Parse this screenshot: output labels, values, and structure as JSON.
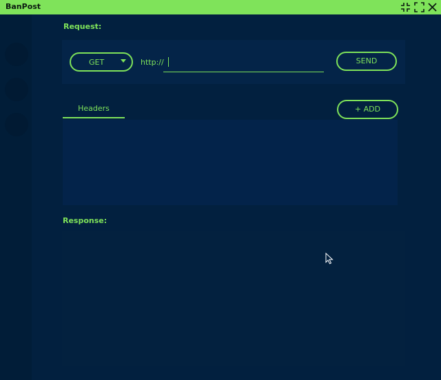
{
  "window": {
    "title": "BanPost"
  },
  "titlebar_icons": [
    "collapse-icon",
    "fullscreen-icon",
    "close-icon"
  ],
  "request": {
    "label": "Request:",
    "method": "GET",
    "protocol_prefix": "http://",
    "url_value": "",
    "send_label": "SEND"
  },
  "headers": {
    "tab_label": "Headers",
    "add_label": "+ ADD"
  },
  "response": {
    "label": "Response:"
  },
  "colors": {
    "accent": "#7fe35a",
    "background": "#02203f",
    "panel": "#03234a"
  }
}
